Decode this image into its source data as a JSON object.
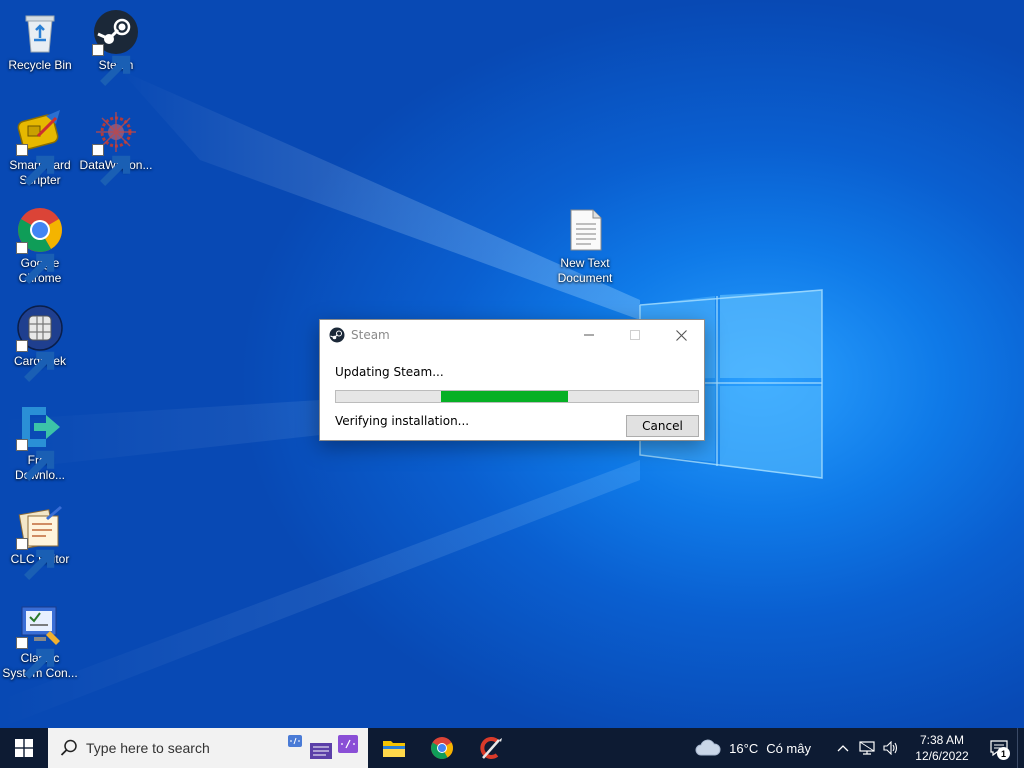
{
  "desktop": {
    "icons": [
      {
        "label": "Recycle Bin"
      },
      {
        "label": "Steam"
      },
      {
        "label": "Smart Card Scripter"
      },
      {
        "label": "DataWagon..."
      },
      {
        "label": "Google Chrome"
      },
      {
        "label": "New Text Document"
      },
      {
        "label": "Cardpeek"
      },
      {
        "label": "Free Downlo..."
      },
      {
        "label": "CLC Editor"
      },
      {
        "label": "Classic System Con..."
      }
    ]
  },
  "dialog": {
    "title": "Steam",
    "status_text": "Updating Steam...",
    "detail_text": "Verifying installation...",
    "cancel_label": "Cancel",
    "progress_start": 0.29,
    "progress_end": 0.64,
    "progress_color": "#06b025"
  },
  "taskbar": {
    "search_placeholder": "Type here to search",
    "weather_temp": "16°C",
    "weather_condition": "Có mây",
    "clock_time": "7:38 AM",
    "clock_date": "12/6/2022",
    "notification_count": "1"
  },
  "colors": {
    "taskbar_bg": "#0d1b33",
    "accent_blue": "#0a78e6"
  }
}
